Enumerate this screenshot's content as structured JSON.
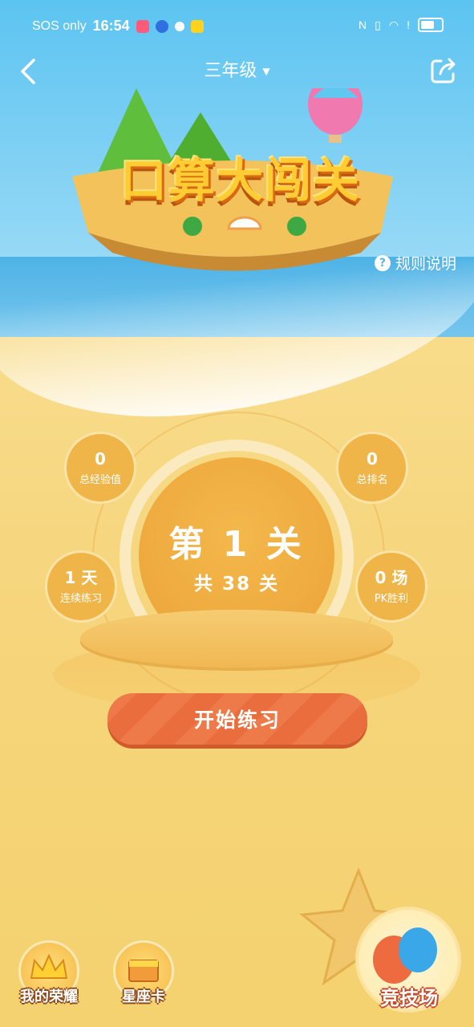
{
  "status_bar": {
    "carrier": "SOS only",
    "time": "16:54"
  },
  "header": {
    "grade": "三年级",
    "back_icon": "chevron-left-icon",
    "share_icon": "share-icon"
  },
  "hero": {
    "title": "口算大闯关",
    "rules_label": "规则说明"
  },
  "stats": {
    "exp": {
      "value": "0",
      "label": "总经验值"
    },
    "rank": {
      "value": "0",
      "label": "总排名"
    },
    "streak": {
      "value": "1 天",
      "label": "连续练习"
    },
    "pk_wins": {
      "value": "0 场",
      "label": "PK胜利"
    }
  },
  "level": {
    "current": "第 1 关",
    "total": "共 38 关"
  },
  "start_button": "开始练习",
  "bottom": {
    "honor": "我的荣耀",
    "zodiac": "星座卡",
    "arena": "竞技场"
  },
  "colors": {
    "sky": "#5cc4f1",
    "sand": "#f6d77f",
    "orange": "#ef7a49",
    "stat": "#f0b548"
  }
}
